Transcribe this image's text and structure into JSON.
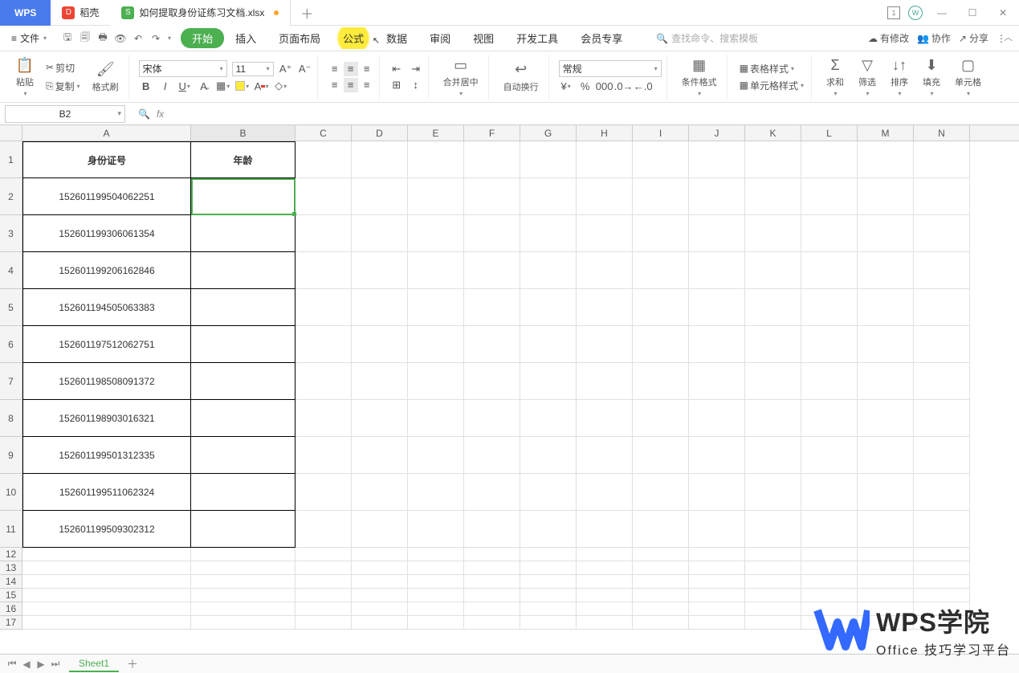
{
  "tabs": {
    "wps": "WPS",
    "daoke": "稻壳",
    "file": "如何提取身份证练习文档.xlsx"
  },
  "menu": {
    "file": "文件",
    "start": "开始",
    "insert": "插入",
    "layout": "页面布局",
    "formula": "公式",
    "data": "数据",
    "review": "审阅",
    "view": "视图",
    "dev": "开发工具",
    "vip": "会员专享"
  },
  "search_placeholder": "查找命令、搜索模板",
  "right_menu": {
    "changes": "有修改",
    "coop": "协作",
    "share": "分享"
  },
  "ribbon": {
    "paste": "粘贴",
    "cut": "剪切",
    "copy": "复制",
    "format_painter": "格式刷",
    "font_name": "宋体",
    "font_size": "11",
    "merge": "合并居中",
    "wrap": "自动换行",
    "num_format": "常规",
    "cond": "条件格式",
    "table_style": "表格样式",
    "cell_style": "单元格样式",
    "sum": "求和",
    "filter": "筛选",
    "sort": "排序",
    "fill": "填充",
    "cell": "单元格"
  },
  "namebox": "B2",
  "columns": [
    "A",
    "B",
    "C",
    "D",
    "E",
    "F",
    "G",
    "H",
    "I",
    "J",
    "K",
    "L",
    "M",
    "N"
  ],
  "col_widths": {
    "A": 210,
    "B": 130,
    "rest": 70
  },
  "row_heights": {
    "data": 46,
    "thin": 17
  },
  "data_rows": 11,
  "thin_rows": [
    "12",
    "13",
    "14",
    "15",
    "16",
    "17"
  ],
  "sheet_tab": "Sheet1",
  "table": {
    "headers": {
      "A": "身份证号",
      "B": "年龄"
    },
    "rows": [
      {
        "A": "152601199504062251",
        "B": ""
      },
      {
        "A": "152601199306061354",
        "B": ""
      },
      {
        "A": "152601199206162846",
        "B": ""
      },
      {
        "A": "152601194505063383",
        "B": ""
      },
      {
        "A": "152601197512062751",
        "B": ""
      },
      {
        "A": "152601198508091372",
        "B": ""
      },
      {
        "A": "152601198903016321",
        "B": ""
      },
      {
        "A": "152601199501312335",
        "B": ""
      },
      {
        "A": "152601199511062324",
        "B": ""
      },
      {
        "A": "152601199509302312",
        "B": ""
      }
    ]
  },
  "watermark": {
    "l1": "WPS学院",
    "l2": "Office 技巧学习平台"
  },
  "active_cell": {
    "col": "B",
    "row": 2
  }
}
